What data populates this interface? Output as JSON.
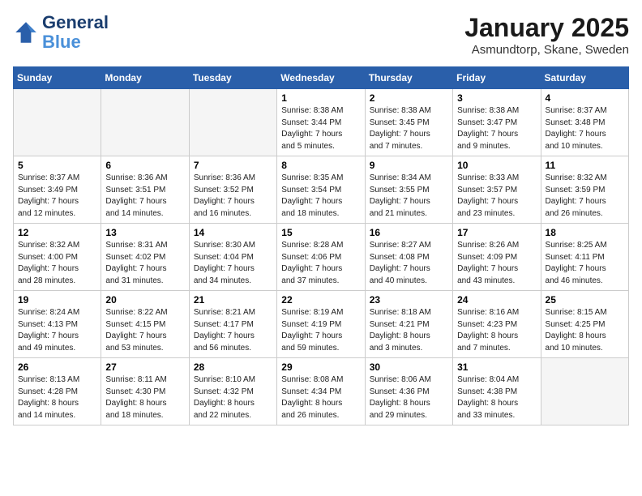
{
  "logo": {
    "line1": "General",
    "line2": "Blue"
  },
  "title": "January 2025",
  "location": "Asmundtorp, Skane, Sweden",
  "weekdays": [
    "Sunday",
    "Monday",
    "Tuesday",
    "Wednesday",
    "Thursday",
    "Friday",
    "Saturday"
  ],
  "weeks": [
    [
      {
        "day": "",
        "info": ""
      },
      {
        "day": "",
        "info": ""
      },
      {
        "day": "",
        "info": ""
      },
      {
        "day": "1",
        "info": "Sunrise: 8:38 AM\nSunset: 3:44 PM\nDaylight: 7 hours\nand 5 minutes."
      },
      {
        "day": "2",
        "info": "Sunrise: 8:38 AM\nSunset: 3:45 PM\nDaylight: 7 hours\nand 7 minutes."
      },
      {
        "day": "3",
        "info": "Sunrise: 8:38 AM\nSunset: 3:47 PM\nDaylight: 7 hours\nand 9 minutes."
      },
      {
        "day": "4",
        "info": "Sunrise: 8:37 AM\nSunset: 3:48 PM\nDaylight: 7 hours\nand 10 minutes."
      }
    ],
    [
      {
        "day": "5",
        "info": "Sunrise: 8:37 AM\nSunset: 3:49 PM\nDaylight: 7 hours\nand 12 minutes."
      },
      {
        "day": "6",
        "info": "Sunrise: 8:36 AM\nSunset: 3:51 PM\nDaylight: 7 hours\nand 14 minutes."
      },
      {
        "day": "7",
        "info": "Sunrise: 8:36 AM\nSunset: 3:52 PM\nDaylight: 7 hours\nand 16 minutes."
      },
      {
        "day": "8",
        "info": "Sunrise: 8:35 AM\nSunset: 3:54 PM\nDaylight: 7 hours\nand 18 minutes."
      },
      {
        "day": "9",
        "info": "Sunrise: 8:34 AM\nSunset: 3:55 PM\nDaylight: 7 hours\nand 21 minutes."
      },
      {
        "day": "10",
        "info": "Sunrise: 8:33 AM\nSunset: 3:57 PM\nDaylight: 7 hours\nand 23 minutes."
      },
      {
        "day": "11",
        "info": "Sunrise: 8:32 AM\nSunset: 3:59 PM\nDaylight: 7 hours\nand 26 minutes."
      }
    ],
    [
      {
        "day": "12",
        "info": "Sunrise: 8:32 AM\nSunset: 4:00 PM\nDaylight: 7 hours\nand 28 minutes."
      },
      {
        "day": "13",
        "info": "Sunrise: 8:31 AM\nSunset: 4:02 PM\nDaylight: 7 hours\nand 31 minutes."
      },
      {
        "day": "14",
        "info": "Sunrise: 8:30 AM\nSunset: 4:04 PM\nDaylight: 7 hours\nand 34 minutes."
      },
      {
        "day": "15",
        "info": "Sunrise: 8:28 AM\nSunset: 4:06 PM\nDaylight: 7 hours\nand 37 minutes."
      },
      {
        "day": "16",
        "info": "Sunrise: 8:27 AM\nSunset: 4:08 PM\nDaylight: 7 hours\nand 40 minutes."
      },
      {
        "day": "17",
        "info": "Sunrise: 8:26 AM\nSunset: 4:09 PM\nDaylight: 7 hours\nand 43 minutes."
      },
      {
        "day": "18",
        "info": "Sunrise: 8:25 AM\nSunset: 4:11 PM\nDaylight: 7 hours\nand 46 minutes."
      }
    ],
    [
      {
        "day": "19",
        "info": "Sunrise: 8:24 AM\nSunset: 4:13 PM\nDaylight: 7 hours\nand 49 minutes."
      },
      {
        "day": "20",
        "info": "Sunrise: 8:22 AM\nSunset: 4:15 PM\nDaylight: 7 hours\nand 53 minutes."
      },
      {
        "day": "21",
        "info": "Sunrise: 8:21 AM\nSunset: 4:17 PM\nDaylight: 7 hours\nand 56 minutes."
      },
      {
        "day": "22",
        "info": "Sunrise: 8:19 AM\nSunset: 4:19 PM\nDaylight: 7 hours\nand 59 minutes."
      },
      {
        "day": "23",
        "info": "Sunrise: 8:18 AM\nSunset: 4:21 PM\nDaylight: 8 hours\nand 3 minutes."
      },
      {
        "day": "24",
        "info": "Sunrise: 8:16 AM\nSunset: 4:23 PM\nDaylight: 8 hours\nand 7 minutes."
      },
      {
        "day": "25",
        "info": "Sunrise: 8:15 AM\nSunset: 4:25 PM\nDaylight: 8 hours\nand 10 minutes."
      }
    ],
    [
      {
        "day": "26",
        "info": "Sunrise: 8:13 AM\nSunset: 4:28 PM\nDaylight: 8 hours\nand 14 minutes."
      },
      {
        "day": "27",
        "info": "Sunrise: 8:11 AM\nSunset: 4:30 PM\nDaylight: 8 hours\nand 18 minutes."
      },
      {
        "day": "28",
        "info": "Sunrise: 8:10 AM\nSunset: 4:32 PM\nDaylight: 8 hours\nand 22 minutes."
      },
      {
        "day": "29",
        "info": "Sunrise: 8:08 AM\nSunset: 4:34 PM\nDaylight: 8 hours\nand 26 minutes."
      },
      {
        "day": "30",
        "info": "Sunrise: 8:06 AM\nSunset: 4:36 PM\nDaylight: 8 hours\nand 29 minutes."
      },
      {
        "day": "31",
        "info": "Sunrise: 8:04 AM\nSunset: 4:38 PM\nDaylight: 8 hours\nand 33 minutes."
      },
      {
        "day": "",
        "info": ""
      }
    ]
  ]
}
